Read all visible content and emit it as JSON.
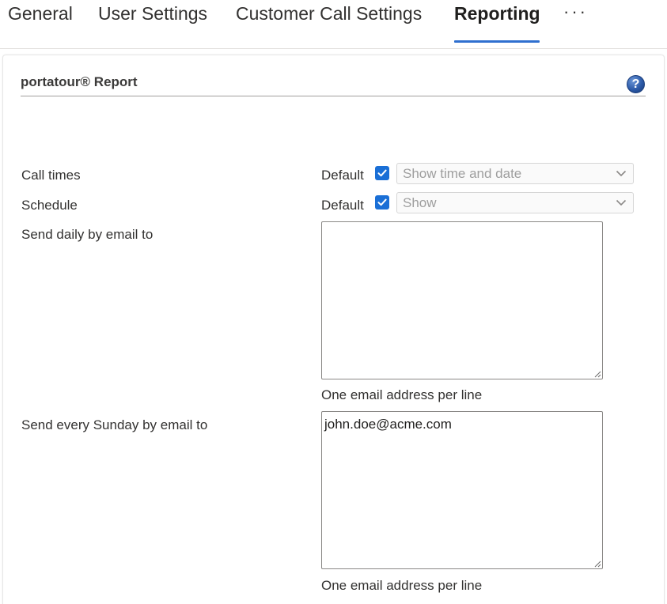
{
  "tabs": [
    {
      "label": "General"
    },
    {
      "label": "User Settings"
    },
    {
      "label": "Customer Call Settings"
    },
    {
      "label": "Reporting",
      "active": true
    }
  ],
  "tabs_more": "···",
  "section": {
    "title": "portatour® Report",
    "help": "?"
  },
  "call_times": {
    "label": "Call times",
    "default_label": "Default",
    "default_checked": true,
    "selected": "Show time and date"
  },
  "schedule": {
    "label": "Schedule",
    "default_label": "Default",
    "default_checked": true,
    "selected": "Show"
  },
  "daily_email": {
    "label": "Send daily by email to",
    "value": "",
    "hint": "One email address per line"
  },
  "sunday_email": {
    "label": "Send every Sunday by email to",
    "value": "john.doe@acme.com",
    "hint": "One email address per line"
  },
  "colors": {
    "accent": "#2f6fcf",
    "checkbox": "#1a6fd6"
  }
}
